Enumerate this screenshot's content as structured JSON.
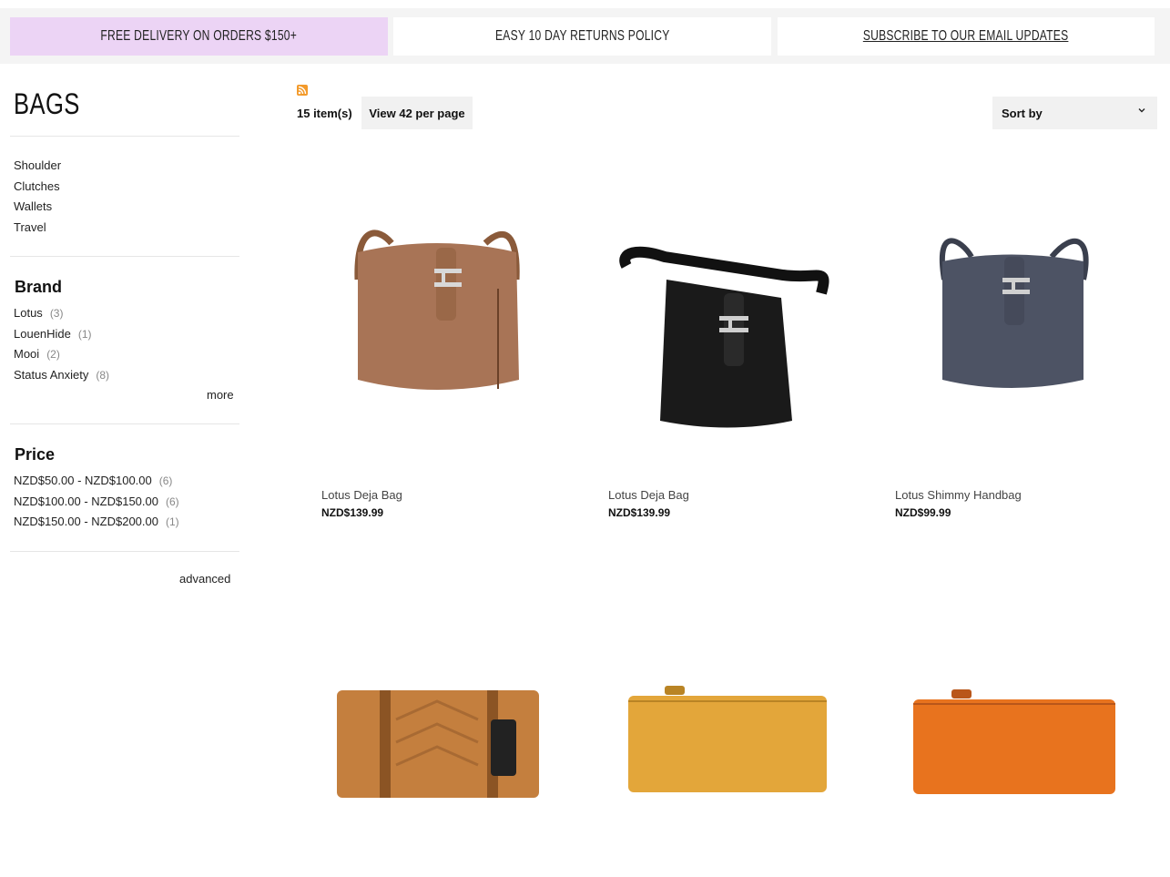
{
  "promo": {
    "free_delivery": "FREE DELIVERY ON ORDERS $150+",
    "returns": "EASY 10 DAY RETURNS POLICY",
    "subscribe": "SUBSCRIBE TO OUR EMAIL UPDATES"
  },
  "colors": {
    "promo_highlight": "#ecd4f5",
    "toolbar_bg": "#f1f1f1",
    "rss": "#f39a2b"
  },
  "sidebar": {
    "title": "BAGS",
    "categories": [
      "Shoulder",
      "Clutches",
      "Wallets",
      "Travel"
    ],
    "brand": {
      "title": "Brand",
      "items": [
        {
          "label": "Lotus",
          "count": "(3)"
        },
        {
          "label": "LouenHide",
          "count": "(1)"
        },
        {
          "label": "Mooi",
          "count": "(2)"
        },
        {
          "label": "Status Anxiety",
          "count": "(8)"
        }
      ],
      "more": "more"
    },
    "price": {
      "title": "Price",
      "items": [
        {
          "label": "NZD$50.00 - NZD$100.00",
          "count": "(6)"
        },
        {
          "label": "NZD$100.00 - NZD$150.00",
          "count": "(6)"
        },
        {
          "label": "NZD$150.00 - NZD$200.00",
          "count": "(1)"
        }
      ]
    },
    "advanced": "advanced"
  },
  "toolbar": {
    "rss_icon": "rss-icon",
    "item_count": "15 item(s)",
    "per_page": "View 42 per page",
    "sort_label": "Sort by",
    "sort_icon": "chevron-down-icon"
  },
  "products": [
    {
      "name": "Lotus Deja Bag",
      "price": "NZD$139.99",
      "image": "tan shoulder bag"
    },
    {
      "name": "Lotus Deja Bag",
      "price": "NZD$139.99",
      "image": "black shoulder bag"
    },
    {
      "name": "Lotus Shimmy Handbag",
      "price": "NZD$99.99",
      "image": "grey handbag"
    },
    {
      "name": "",
      "price": "",
      "image": "tan zip clutch"
    },
    {
      "name": "",
      "price": "",
      "image": "mustard wallet"
    },
    {
      "name": "",
      "price": "",
      "image": "orange wallet"
    }
  ]
}
